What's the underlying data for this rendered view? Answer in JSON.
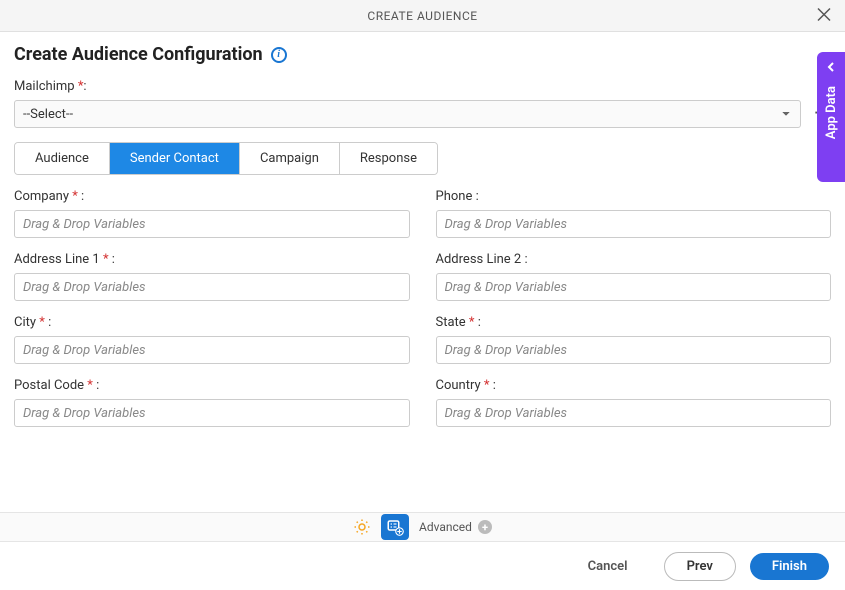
{
  "modal_title": "CREATE AUDIENCE",
  "page_title": "Create Audience Configuration",
  "select_field": {
    "label": "Mailchimp",
    "required": "*",
    "colon": ":",
    "value": "--Select--"
  },
  "tabs": {
    "audience": "Audience",
    "sender_contact": "Sender Contact",
    "campaign": "Campaign",
    "response": "Response"
  },
  "fields": {
    "placeholder": "Drag & Drop Variables",
    "company": {
      "label": "Company",
      "required": " *",
      "colon": " :"
    },
    "phone": {
      "label": "Phone",
      "required": "",
      "colon": " :"
    },
    "address1": {
      "label": "Address Line 1",
      "required": " *",
      "colon": " :"
    },
    "address2": {
      "label": "Address Line 2",
      "required": "",
      "colon": " :"
    },
    "city": {
      "label": "City",
      "required": " *",
      "colon": " :"
    },
    "state": {
      "label": "State",
      "required": " *",
      "colon": " :"
    },
    "postal": {
      "label": "Postal Code",
      "required": " *",
      "colon": " :"
    },
    "country": {
      "label": "Country",
      "required": " *",
      "colon": " :"
    }
  },
  "side_panel": "App Data",
  "toolbar": {
    "advanced": "Advanced"
  },
  "footer": {
    "cancel": "Cancel",
    "prev": "Prev",
    "finish": "Finish"
  }
}
